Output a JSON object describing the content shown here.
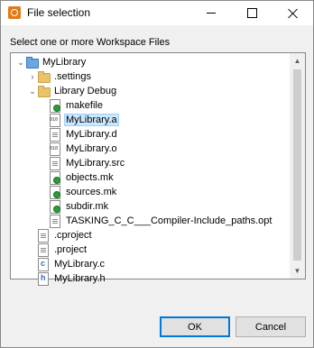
{
  "window": {
    "title": "File selection",
    "controls": [
      "minimize",
      "maximize",
      "close"
    ]
  },
  "prompt": "Select one or more Workspace Files",
  "tree": {
    "items": [
      {
        "label": "MyLibrary",
        "icon": "project-folder-icon",
        "depth": 0,
        "expanded": true,
        "selected": false
      },
      {
        "label": ".settings",
        "icon": "folder-icon",
        "depth": 1,
        "expanded": false,
        "selected": false
      },
      {
        "label": "Library Debug",
        "icon": "folder-icon",
        "depth": 1,
        "expanded": true,
        "selected": false
      },
      {
        "label": "makefile",
        "icon": "makefile-icon",
        "depth": 2,
        "selected": false
      },
      {
        "label": "MyLibrary.a",
        "icon": "binary-file-icon",
        "depth": 2,
        "selected": true
      },
      {
        "label": "MyLibrary.d",
        "icon": "text-file-icon",
        "depth": 2,
        "selected": false
      },
      {
        "label": "MyLibrary.o",
        "icon": "binary-file-icon",
        "depth": 2,
        "selected": false
      },
      {
        "label": "MyLibrary.src",
        "icon": "text-file-icon",
        "depth": 2,
        "selected": false
      },
      {
        "label": "objects.mk",
        "icon": "makefile-icon",
        "depth": 2,
        "selected": false
      },
      {
        "label": "sources.mk",
        "icon": "makefile-icon",
        "depth": 2,
        "selected": false
      },
      {
        "label": "subdir.mk",
        "icon": "makefile-icon",
        "depth": 2,
        "selected": false
      },
      {
        "label": "TASKING_C_C___Compiler-Include_paths.opt",
        "icon": "text-file-icon",
        "depth": 2,
        "selected": false
      },
      {
        "label": ".cproject",
        "icon": "text-file-icon",
        "depth": 1,
        "selected": false
      },
      {
        "label": ".project",
        "icon": "text-file-icon",
        "depth": 1,
        "selected": false
      },
      {
        "label": "MyLibrary.c",
        "icon": "c-source-icon",
        "depth": 1,
        "selected": false
      },
      {
        "label": "MyLibrary.h",
        "icon": "c-header-icon",
        "depth": 1,
        "selected": false
      }
    ]
  },
  "buttons": {
    "ok": "OK",
    "cancel": "Cancel"
  }
}
